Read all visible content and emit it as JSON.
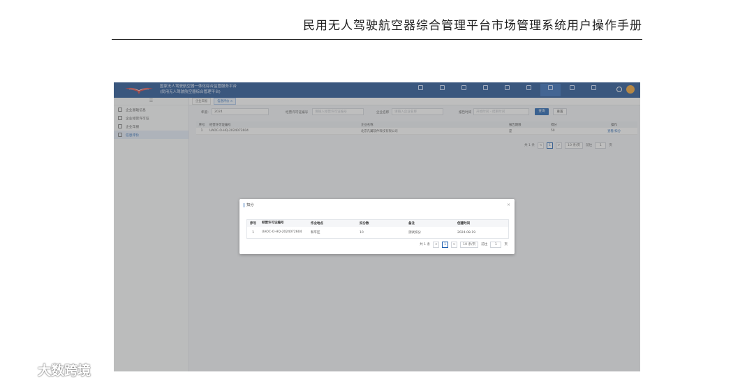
{
  "doc": {
    "title": "民用无人驾驶航空器综合管理平台市场管理系统用户操作手册"
  },
  "app": {
    "system_title_line1": "国家无人驾驶航空器一体化综合监管服务平台",
    "system_title_line2": "(民用无人驾驶航空器综合管理平台)",
    "accent_color": "#1d5fb0"
  },
  "sidebar": {
    "collapse_label": "☰",
    "items": [
      {
        "label": "企业基础信息",
        "icon": "user-icon"
      },
      {
        "label": "企业经营许可证",
        "icon": "certificate-icon"
      },
      {
        "label": "企业年报",
        "icon": "report-icon"
      },
      {
        "label": "信息评价",
        "icon": "rating-icon"
      }
    ]
  },
  "tabs": [
    {
      "label": "企业年报"
    },
    {
      "label": "信息评价 ×"
    }
  ],
  "filters": {
    "year_label": "年度:",
    "year_value": "2024",
    "license_label": "经营许可证编号",
    "license_placeholder": "请输入经营许可证编号",
    "company_label": "企业名称",
    "company_placeholder": "请输入企业名称",
    "date_label": "报告时间",
    "date_placeholder": "开始时间 - 结束时间",
    "search_label": "查询",
    "reset_label": "重置"
  },
  "main_table": {
    "columns": [
      "序号",
      "经营许可证编号",
      "企业名称",
      "报告期限",
      "得分",
      "操作"
    ],
    "rows": [
      {
        "no": "1",
        "license": "UAOC-O-HQ-2024072604",
        "company": "北京凡翼软件科技有限公司",
        "period": "是",
        "score": "50",
        "action": "查看/扣分"
      }
    ]
  },
  "main_pager": {
    "total": "共 1 条",
    "prev": "<",
    "current": "1",
    "next": ">",
    "page_size": "10 条/页",
    "goto_label": "前往",
    "goto_value": "1",
    "goto_suffix": "页"
  },
  "modal": {
    "title": "扣分",
    "close": "×",
    "columns": [
      "序号",
      "经营许可证编号",
      "作业地点",
      "扣分数",
      "备注",
      "创建时间"
    ],
    "rows": [
      {
        "no": "1",
        "license": "UAOC-O-HQ-2024072604",
        "place": "和平区",
        "deduct": "10",
        "remark": "测试扣分",
        "created": "2024-08-19"
      }
    ],
    "pager": {
      "total": "共 1 条",
      "prev": "<",
      "current": "1",
      "next": ">",
      "page_size": "10 条/页",
      "goto_label": "前往",
      "goto_value": "1",
      "goto_suffix": "页"
    }
  },
  "watermark": {
    "text": "大数跨境"
  }
}
